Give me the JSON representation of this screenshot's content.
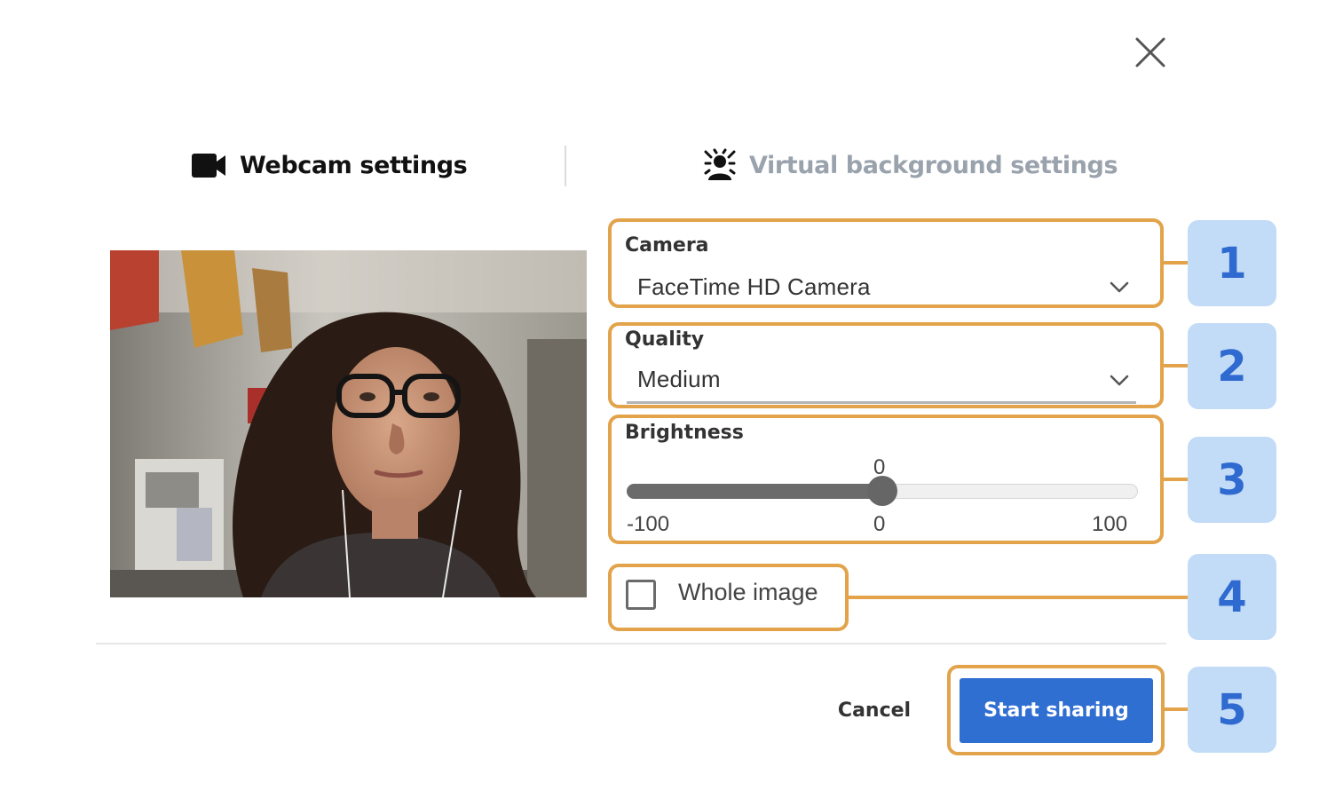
{
  "dialog": {
    "tabs": [
      {
        "label": "Webcam settings",
        "icon": "video-camera-icon",
        "active": true
      },
      {
        "label": "Virtual background settings",
        "icon": "virtual-background-icon",
        "active": false
      }
    ],
    "close_icon": "close-icon"
  },
  "form": {
    "camera": {
      "label": "Camera",
      "value": "FaceTime HD Camera"
    },
    "quality": {
      "label": "Quality",
      "value": "Medium"
    },
    "brightness": {
      "label": "Brightness",
      "value": 0,
      "value_text": "0",
      "min_text": "-100",
      "mid_text": "0",
      "max_text": "100",
      "min": -100,
      "max": 100
    },
    "whole_image": {
      "label": "Whole image",
      "checked": false
    }
  },
  "actions": {
    "cancel_label": "Cancel",
    "start_label": "Start sharing"
  },
  "callouts": [
    "1",
    "2",
    "3",
    "4",
    "5"
  ],
  "colors": {
    "accent": "#2f6fd2",
    "highlight": "#e2a34b",
    "badge_bg": "#c2dbf6",
    "badge_text": "#2f6ad0"
  }
}
